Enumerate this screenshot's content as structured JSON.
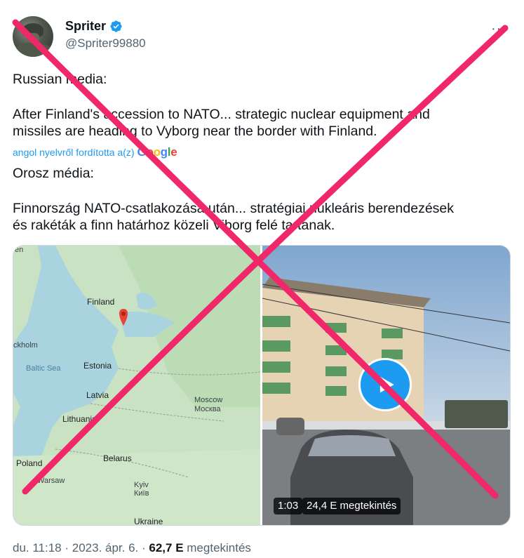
{
  "author": {
    "name": "Spriter",
    "handle": "@Spriter99880",
    "more": "···"
  },
  "tweet": {
    "para1": "Russian media:",
    "para2": "After Finland's accession to NATO... strategic nuclear equipment and\nmissiles are heading to Vyborg near the border with Finland.",
    "translated_label": "angol nyelvről fordította a(z)",
    "translator": "Google",
    "para3": "Orosz média:",
    "para4": "Finnország NATO-csatlakozása után... stratégiai nukleáris berendezések\nés rakéták a finn határhoz közeli Viborg felé tartanak."
  },
  "map": {
    "labels": {
      "finland": "Finland",
      "stockholm": "ckholm",
      "baltic": "Baltic Sea",
      "estonia": "Estonia",
      "latvia": "Latvia",
      "lithuania": "Lithuania",
      "poland": "Poland",
      "warsaw": "Warsaw",
      "belarus": "Belarus",
      "moscow": "Moscow",
      "moscow_ru": "Москва",
      "kyiv": "Kyiv",
      "kyiv_ua": "Київ",
      "ukraine": "Ukraine",
      "corner": "en"
    }
  },
  "video": {
    "duration": "1:03",
    "views_badge": "24,4 E megtekintés"
  },
  "footer": {
    "time": "du. 11:18",
    "sep1": " · ",
    "date": "2023. ápr. 6.",
    "sep2": " · ",
    "views": "62,7 E",
    "views_label": " megtekintés"
  },
  "colors": {
    "accent": "#1d9bf0",
    "cross": "#f0286a"
  }
}
